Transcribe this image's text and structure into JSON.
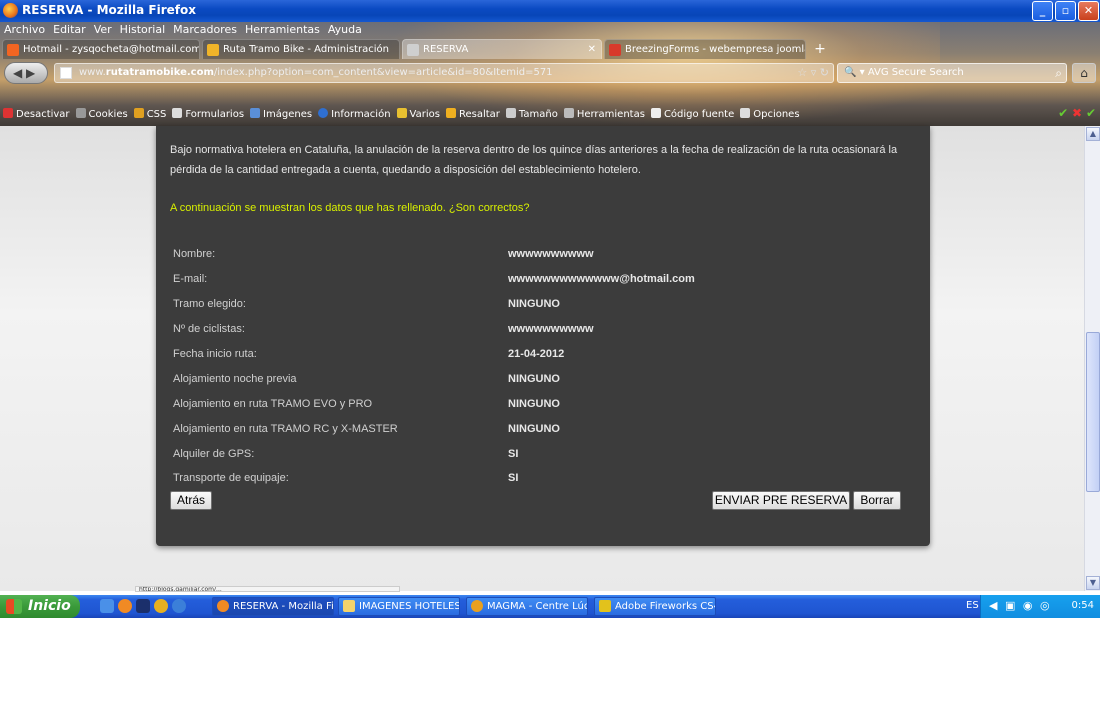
{
  "window": {
    "title": "RESERVA - Mozilla Firefox"
  },
  "menu": [
    "Archivo",
    "Editar",
    "Ver",
    "Historial",
    "Marcadores",
    "Herramientas",
    "Ayuda"
  ],
  "tabs": [
    {
      "label": "Hotmail - zysqocheta@hotmail.com",
      "icon_color": "#f26522"
    },
    {
      "label": "Ruta Tramo Bike - Administración",
      "icon_color": "#f0b429"
    },
    {
      "label": "RESERVA",
      "icon_color": "#cfcfcf"
    },
    {
      "label": "BreezingForms - webempresa joomla - Ho...",
      "icon_color": "#d83a2b"
    }
  ],
  "address": {
    "prefix": "www.",
    "domain": "rutatramobike.com",
    "path": "/index.php?option=com_content&view=article&id=80&Itemid=571",
    "search_placeholder": "AVG Secure Search"
  },
  "devtoolbar": [
    "Desactivar",
    "Cookies",
    "CSS",
    "Formularios",
    "Imágenes",
    "Información",
    "Varios",
    "Resaltar",
    "Tamaño",
    "Herramientas",
    "Código fuente",
    "Opciones"
  ],
  "page": {
    "intro": "Bajo normativa hotelera en Cataluña, la anulación de la reserva dentro de los quince días anteriores a la fecha de realización de la ruta ocasionará la pérdida de la cantidad entregada a cuenta, quedando a disposición del establecimiento hotelero.",
    "question": "A continuación se muestran los datos  que has rellenado. ¿Son correctos?",
    "fields": [
      {
        "label": "Nombre:",
        "value": "wwwwwwwwww"
      },
      {
        "label": "E-mail:",
        "value": "wwwwwwwwwwwww@hotmail.com"
      },
      {
        "label": "Tramo elegido:",
        "value": "NINGUNO"
      },
      {
        "label": "Nº de ciclistas:",
        "value": "wwwwwwwwww"
      },
      {
        "label": "Fecha inicio ruta:",
        "value": "21-04-2012"
      },
      {
        "label": "Alojamiento noche previa",
        "value": "NINGUNO"
      },
      {
        "label": "Alojamiento en ruta TRAMO EVO y PRO",
        "value": "NINGUNO"
      },
      {
        "label": "Alojamiento en ruta TRAMO RC y X-MASTER",
        "value": "NINGUNO"
      },
      {
        "label": "Alquiler de GPS:",
        "value": "SI"
      },
      {
        "label": "Transporte de equipaje:",
        "value": "SI"
      }
    ],
    "buttons": {
      "back": "Atrás",
      "send": "ENVIAR PRE RESERVA",
      "clear": "Borrar"
    }
  },
  "status_url": "http://blogs.gamiliar.com/...",
  "taskbar": {
    "start": "Inicio",
    "tasks": [
      {
        "label": "RESERVA - Mozilla Fir...",
        "icon_color": "#f08a24"
      },
      {
        "label": "IMAGENES HOTELES",
        "icon_color": "#f3d36b"
      },
      {
        "label": "MAGMA - Centre Lúdi...",
        "icon_color": "#e8a020"
      },
      {
        "label": "Adobe Fireworks CS4",
        "icon_color": "#e2c21c"
      }
    ],
    "lang": "ES",
    "clock": "0:54"
  }
}
